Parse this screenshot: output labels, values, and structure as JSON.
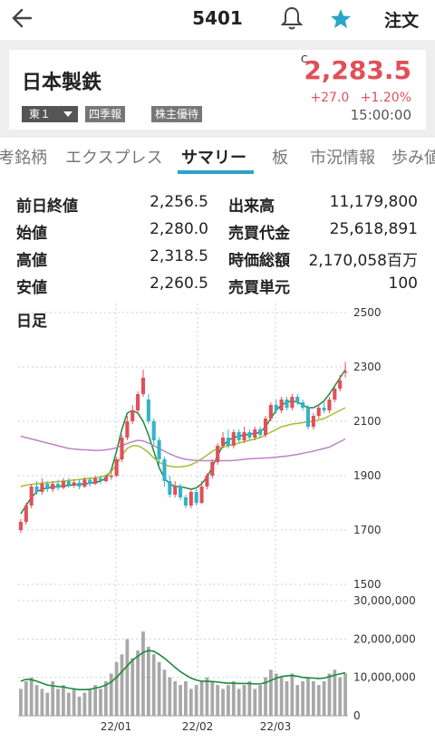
{
  "header": {
    "code": "5401",
    "order_label": "注文"
  },
  "stock": {
    "name": "日本製鉄",
    "market": "東１",
    "tags": [
      "四季報",
      "株主優待"
    ],
    "price_flag": "C",
    "price": "2,283.5",
    "change": "+27.0",
    "change_pct": "+1.20%",
    "time": "15:00:00"
  },
  "tabs": [
    "考銘柄",
    "エクスプレス",
    "サマリー",
    "板",
    "市況情報",
    "歩み値"
  ],
  "active_tab": "サマリー",
  "summary": {
    "left": [
      {
        "label": "前日終値",
        "value": "2,256.5"
      },
      {
        "label": "始値",
        "value": "2,280.0"
      },
      {
        "label": "高値",
        "value": "2,318.5"
      },
      {
        "label": "安値",
        "value": "2,260.5"
      }
    ],
    "right": [
      {
        "label": "出来高",
        "value": "11,179,800"
      },
      {
        "label": "売買代金",
        "value": "25,618,891"
      },
      {
        "label": "時価総額",
        "value": "2,170,058百万"
      },
      {
        "label": "売買単元",
        "value": "100"
      }
    ]
  },
  "chart_data": {
    "type": "line",
    "label": "日足",
    "price_axis_ticks": [
      "2500",
      "2300",
      "2100",
      "1900",
      "1700",
      "1500"
    ],
    "price_ylim": [
      1500,
      2500
    ],
    "volume_axis_ticks": [
      "30,000,000",
      "20,000,000",
      "10,000,000",
      "0"
    ],
    "volume_ylim": [
      0,
      30000000
    ],
    "x_ticks": [
      "22/01",
      "22/02",
      "22/03"
    ],
    "grid": true,
    "candles": [
      {
        "o": 1700,
        "c": 1730,
        "h": 1740,
        "l": 1690
      },
      {
        "o": 1730,
        "c": 1790,
        "h": 1800,
        "l": 1720
      },
      {
        "o": 1790,
        "c": 1860,
        "h": 1870,
        "l": 1780
      },
      {
        "o": 1860,
        "c": 1840,
        "h": 1880,
        "l": 1830
      },
      {
        "o": 1840,
        "c": 1870,
        "h": 1890,
        "l": 1830
      },
      {
        "o": 1870,
        "c": 1850,
        "h": 1880,
        "l": 1840
      },
      {
        "o": 1850,
        "c": 1870,
        "h": 1880,
        "l": 1840
      },
      {
        "o": 1870,
        "c": 1855,
        "h": 1885,
        "l": 1845
      },
      {
        "o": 1855,
        "c": 1880,
        "h": 1890,
        "l": 1850
      },
      {
        "o": 1880,
        "c": 1865,
        "h": 1890,
        "l": 1855
      },
      {
        "o": 1865,
        "c": 1875,
        "h": 1885,
        "l": 1855
      },
      {
        "o": 1875,
        "c": 1860,
        "h": 1885,
        "l": 1850
      },
      {
        "o": 1860,
        "c": 1885,
        "h": 1895,
        "l": 1855
      },
      {
        "o": 1885,
        "c": 1870,
        "h": 1895,
        "l": 1860
      },
      {
        "o": 1870,
        "c": 1890,
        "h": 1900,
        "l": 1865
      },
      {
        "o": 1890,
        "c": 1880,
        "h": 1900,
        "l": 1870
      },
      {
        "o": 1880,
        "c": 1895,
        "h": 1905,
        "l": 1875
      },
      {
        "o": 1895,
        "c": 1900,
        "h": 1915,
        "l": 1885
      },
      {
        "o": 1900,
        "c": 1960,
        "h": 1970,
        "l": 1895
      },
      {
        "o": 1960,
        "c": 2040,
        "h": 2050,
        "l": 1950
      },
      {
        "o": 2040,
        "c": 2100,
        "h": 2120,
        "l": 2030
      },
      {
        "o": 2100,
        "c": 2140,
        "h": 2160,
        "l": 2090
      },
      {
        "o": 2140,
        "c": 2200,
        "h": 2210,
        "l": 2130
      },
      {
        "o": 2200,
        "c": 2260,
        "h": 2290,
        "l": 2190
      },
      {
        "o": 2180,
        "c": 2100,
        "h": 2200,
        "l": 2090
      },
      {
        "o": 2100,
        "c": 2030,
        "h": 2110,
        "l": 2010
      },
      {
        "o": 2030,
        "c": 1960,
        "h": 2040,
        "l": 1940
      },
      {
        "o": 1960,
        "c": 1880,
        "h": 1970,
        "l": 1860
      },
      {
        "o": 1880,
        "c": 1830,
        "h": 1900,
        "l": 1820
      },
      {
        "o": 1830,
        "c": 1860,
        "h": 1880,
        "l": 1820
      },
      {
        "o": 1860,
        "c": 1820,
        "h": 1870,
        "l": 1810
      },
      {
        "o": 1820,
        "c": 1790,
        "h": 1830,
        "l": 1780
      },
      {
        "o": 1790,
        "c": 1840,
        "h": 1850,
        "l": 1780
      },
      {
        "o": 1840,
        "c": 1800,
        "h": 1850,
        "l": 1790
      },
      {
        "o": 1800,
        "c": 1860,
        "h": 1880,
        "l": 1795
      },
      {
        "o": 1860,
        "c": 1900,
        "h": 1910,
        "l": 1850
      },
      {
        "o": 1900,
        "c": 1950,
        "h": 1960,
        "l": 1890
      },
      {
        "o": 1950,
        "c": 2010,
        "h": 2020,
        "l": 1940
      },
      {
        "o": 2010,
        "c": 2040,
        "h": 2060,
        "l": 2000
      },
      {
        "o": 2040,
        "c": 2010,
        "h": 2070,
        "l": 2000
      },
      {
        "o": 2010,
        "c": 2060,
        "h": 2070,
        "l": 2000
      },
      {
        "o": 2060,
        "c": 2030,
        "h": 2070,
        "l": 2020
      },
      {
        "o": 2030,
        "c": 2060,
        "h": 2080,
        "l": 2020
      },
      {
        "o": 2060,
        "c": 2040,
        "h": 2070,
        "l": 2030
      },
      {
        "o": 2040,
        "c": 2070,
        "h": 2080,
        "l": 2030
      },
      {
        "o": 2070,
        "c": 2050,
        "h": 2080,
        "l": 2040
      },
      {
        "o": 2050,
        "c": 2110,
        "h": 2120,
        "l": 2040
      },
      {
        "o": 2110,
        "c": 2160,
        "h": 2170,
        "l": 2100
      },
      {
        "o": 2160,
        "c": 2140,
        "h": 2180,
        "l": 2130
      },
      {
        "o": 2140,
        "c": 2180,
        "h": 2190,
        "l": 2130
      },
      {
        "o": 2180,
        "c": 2150,
        "h": 2190,
        "l": 2140
      },
      {
        "o": 2150,
        "c": 2190,
        "h": 2200,
        "l": 2140
      },
      {
        "o": 2190,
        "c": 2170,
        "h": 2200,
        "l": 2160
      },
      {
        "o": 2170,
        "c": 2150,
        "h": 2180,
        "l": 2140
      },
      {
        "o": 2150,
        "c": 2080,
        "h": 2160,
        "l": 2070
      },
      {
        "o": 2080,
        "c": 2120,
        "h": 2130,
        "l": 2070
      },
      {
        "o": 2120,
        "c": 2150,
        "h": 2160,
        "l": 2110
      },
      {
        "o": 2150,
        "c": 2140,
        "h": 2170,
        "l": 2130
      },
      {
        "o": 2140,
        "c": 2180,
        "h": 2190,
        "l": 2130
      },
      {
        "o": 2180,
        "c": 2220,
        "h": 2230,
        "l": 2170
      },
      {
        "o": 2220,
        "c": 2250,
        "h": 2270,
        "l": 2210
      },
      {
        "o": 2280,
        "c": 2283.5,
        "h": 2318.5,
        "l": 2260.5
      }
    ],
    "volume": [
      7,
      9,
      10,
      8,
      7,
      6,
      9,
      7,
      8,
      6,
      7,
      5,
      6,
      7,
      8,
      7,
      9,
      11,
      14,
      16,
      20,
      15,
      17,
      22,
      18,
      16,
      14,
      12,
      10,
      9,
      8,
      9,
      7,
      8,
      9,
      10,
      9,
      8,
      7,
      8,
      9,
      7,
      8,
      9,
      7,
      8,
      10,
      12,
      11,
      10,
      9,
      11,
      8,
      9,
      10,
      9,
      8,
      9,
      11,
      12,
      10,
      11
    ],
    "series": [
      {
        "values": [
          1760,
          1790,
          1820,
          1840,
          1850,
          1855,
          1858,
          1860,
          1862,
          1864,
          1866,
          1868,
          1870,
          1872,
          1875,
          1880,
          1890,
          1920,
          1990,
          2070,
          2130,
          2140,
          2130,
          2100,
          2050,
          1990,
          1930,
          1890,
          1870,
          1860,
          1860,
          1855,
          1850,
          1855,
          1870,
          1895,
          1930,
          1975,
          2010,
          2030,
          2040,
          2045,
          2050,
          2052,
          2055,
          2060,
          2080,
          2110,
          2140,
          2160,
          2170,
          2175,
          2170,
          2160,
          2150,
          2150,
          2160,
          2175,
          2200,
          2230,
          2260,
          2290
        ]
      },
      {
        "values": [
          1860,
          1865,
          1868,
          1870,
          1872,
          1874,
          1876,
          1878,
          1880,
          1882,
          1884,
          1886,
          1888,
          1890,
          1892,
          1895,
          1900,
          1915,
          1940,
          1975,
          2000,
          2010,
          2010,
          2000,
          1985,
          1965,
          1950,
          1940,
          1935,
          1932,
          1932,
          1935,
          1940,
          1950,
          1962,
          1975,
          1990,
          2000,
          2005,
          2010,
          2015,
          2020,
          2025,
          2030,
          2035,
          2040,
          2050,
          2060,
          2070,
          2080,
          2085,
          2090,
          2092,
          2095,
          2098,
          2100,
          2105,
          2110,
          2120,
          2130,
          2140,
          2150
        ]
      },
      {
        "values": [
          2045,
          2040,
          2035,
          2030,
          2025,
          2020,
          2015,
          2010,
          2005,
          2000,
          1998,
          1996,
          1995,
          1994,
          1993,
          1993,
          1995,
          1998,
          2003,
          2010,
          2018,
          2025,
          2030,
          2028,
          2020,
          2010,
          2000,
          1990,
          1980,
          1972,
          1965,
          1960,
          1958,
          1956,
          1955,
          1955,
          1955,
          1955,
          1955,
          1955,
          1956,
          1958,
          1960,
          1962,
          1963,
          1964,
          1965,
          1966,
          1968,
          1970,
          1972,
          1975,
          1978,
          1982,
          1986,
          1990,
          1995,
          2000,
          2005,
          2015,
          2025,
          2035
        ]
      }
    ],
    "volume_average": [
      9,
      9.5,
      9.4,
      9,
      8.5,
      8,
      7.8,
      7.6,
      7.5,
      7.2,
      7,
      6.8,
      6.8,
      6.9,
      7.2,
      7.5,
      8,
      8.8,
      10,
      11.5,
      13,
      14.5,
      15.5,
      16.5,
      17,
      16.8,
      16,
      15,
      13.8,
      12.6,
      11.5,
      10.6,
      9.8,
      9.3,
      9,
      9,
      8.9,
      8.8,
      8.6,
      8.5,
      8.5,
      8.4,
      8.4,
      8.4,
      8.3,
      8.3,
      8.6,
      9.2,
      9.8,
      10.2,
      10.4,
      10.5,
      10.3,
      10,
      9.9,
      9.8,
      9.7,
      9.8,
      10.2,
      10.6,
      10.9,
      11.2
    ]
  },
  "colors": {
    "up": "#e0505a",
    "down": "#34b3c9",
    "accent": "#2aa4c8",
    "ma_short": "#1b8a3a",
    "ma_mid": "#a0c030",
    "ma_long": "#c080c8"
  }
}
